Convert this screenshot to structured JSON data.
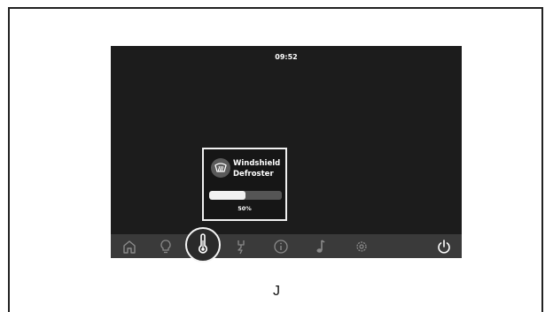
{
  "screen": {
    "clock": "09:52"
  },
  "popup": {
    "title": "Windshield\nDefroster",
    "icon": "windshield-defroster-icon",
    "progress_fraction": 0.5,
    "progress_label": "50%"
  },
  "navbar": {
    "items": [
      {
        "name": "home",
        "icon": "home-icon"
      },
      {
        "name": "lights",
        "icon": "lightbulb-icon"
      },
      {
        "name": "climate",
        "icon": "thermometer-icon",
        "active": true
      },
      {
        "name": "power",
        "icon": "lightning-plug-icon"
      },
      {
        "name": "info",
        "icon": "info-icon"
      },
      {
        "name": "music",
        "icon": "music-note-icon"
      },
      {
        "name": "settings",
        "icon": "gear-icon"
      },
      {
        "name": "power-off",
        "icon": "power-icon"
      }
    ]
  },
  "caption": "J",
  "colors": {
    "screen_bg": "#1c1c1c",
    "navbar_bg": "#3a3a3a",
    "icon_inactive": "#8a8a8a",
    "accent": "#ffffff"
  }
}
